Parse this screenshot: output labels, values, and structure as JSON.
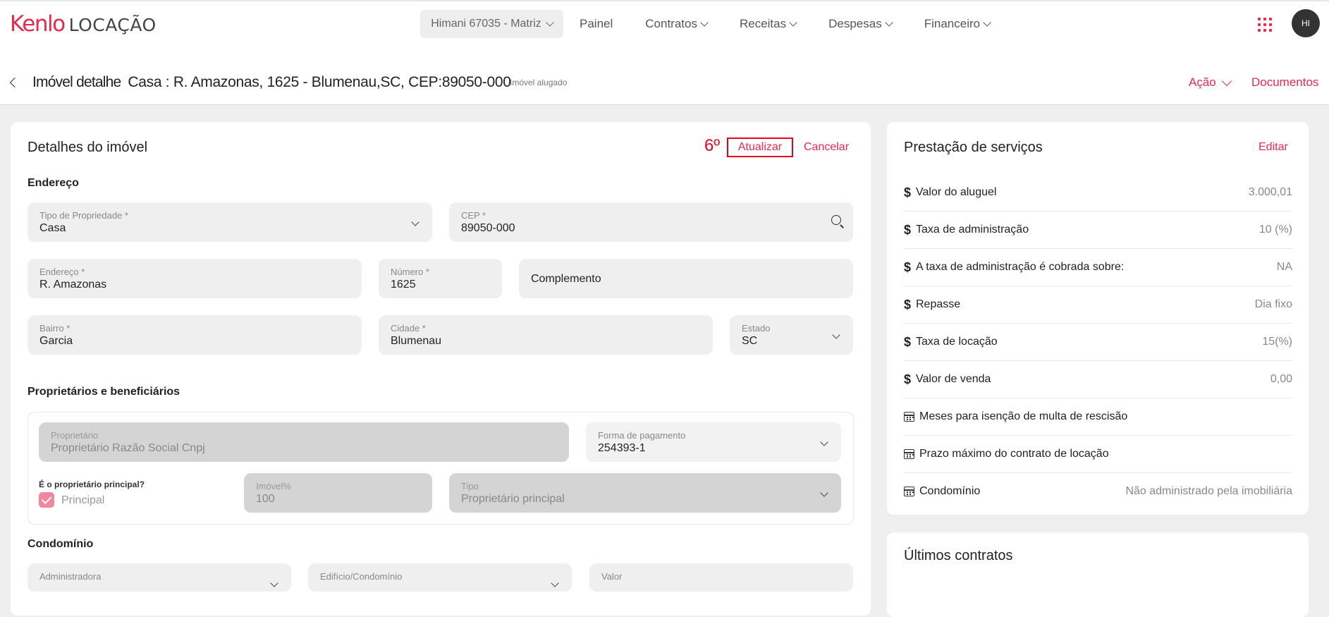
{
  "brand": {
    "kenlo": "Kenlo",
    "locacao": "LOCAÇÃO",
    "accent": "#e8284f"
  },
  "topbar": {
    "company": "Himani 67035 - Matriz",
    "nav": [
      "Painel",
      "Contratos",
      "Receitas",
      "Despesas",
      "Financeiro"
    ],
    "avatar": "HI"
  },
  "page": {
    "title_prefix": "Imóvel detalhe",
    "title_address": "Casa : R. Amazonas, 1625 - Blumenau,SC, CEP:89050-000",
    "status": "Imóvel alugado",
    "acao": "Ação",
    "documentos": "Documentos"
  },
  "details": {
    "title": "Detalhes do imóvel",
    "step": "6º",
    "atualizar": "Atualizar",
    "cancelar": "Cancelar",
    "endereco_section": "Endereço",
    "tipo": {
      "label": "Tipo de Propriedade *",
      "value": "Casa"
    },
    "cep": {
      "label": "CEP *",
      "value": "89050-000"
    },
    "endereco": {
      "label": "Endereço *",
      "value": "R. Amazonas"
    },
    "numero": {
      "label": "Número *",
      "value": "1625"
    },
    "complemento": {
      "placeholder": "Complemento"
    },
    "bairro": {
      "label": "Bairro *",
      "value": "Garcia"
    },
    "cidade": {
      "label": "Cidade *",
      "value": "Blumenau"
    },
    "estado": {
      "label": "Estado",
      "value": "SC"
    },
    "owners_section": "Proprietários e beneficiários",
    "proprietario": {
      "label": "Proprietário",
      "value": "Proprietário Razão Social Cnpj"
    },
    "forma_pagamento": {
      "label": "Forma de pagamento",
      "value": "254393-1"
    },
    "principal_question": "É o proprietário principal?",
    "principal_label": "Principal",
    "imovel_pct": {
      "label": "Imóvel%",
      "value": "100"
    },
    "tipo_owner": {
      "label": "Tipo",
      "value": "Proprietário principal"
    },
    "condominio_section": "Condomínio",
    "administradora": {
      "label": "Administradora"
    },
    "edificio": {
      "label": "Edifício/Condomínio"
    },
    "valor": {
      "label": "Valor"
    }
  },
  "services": {
    "title": "Prestação de serviços",
    "edit": "Editar",
    "rows": [
      {
        "icon": "dollar-icon",
        "label": "Valor do aluguel",
        "value": "3.000,01"
      },
      {
        "icon": "dollar-icon",
        "label": "Taxa de administração",
        "value": "10 (%)"
      },
      {
        "icon": "dollar-icon",
        "label": "A taxa de administração é cobrada sobre:",
        "value": "NA"
      },
      {
        "icon": "dollar-icon",
        "label": "Repasse",
        "value": "Dia fixo"
      },
      {
        "icon": "dollar-icon",
        "label": "Taxa de locação",
        "value": "15(%)"
      },
      {
        "icon": "dollar-icon",
        "label": "Valor de venda",
        "value": "0,00"
      },
      {
        "icon": "calendar-icon",
        "label": "Meses para isenção de multa de rescisão",
        "value": ""
      },
      {
        "icon": "calendar-icon",
        "label": "Prazo máximo do contrato de locação",
        "value": ""
      },
      {
        "icon": "calendar-icon",
        "label": "Condomínio",
        "value": "Não administrado pela imobiliária"
      }
    ]
  },
  "contracts": {
    "title": "Últimos contratos"
  }
}
